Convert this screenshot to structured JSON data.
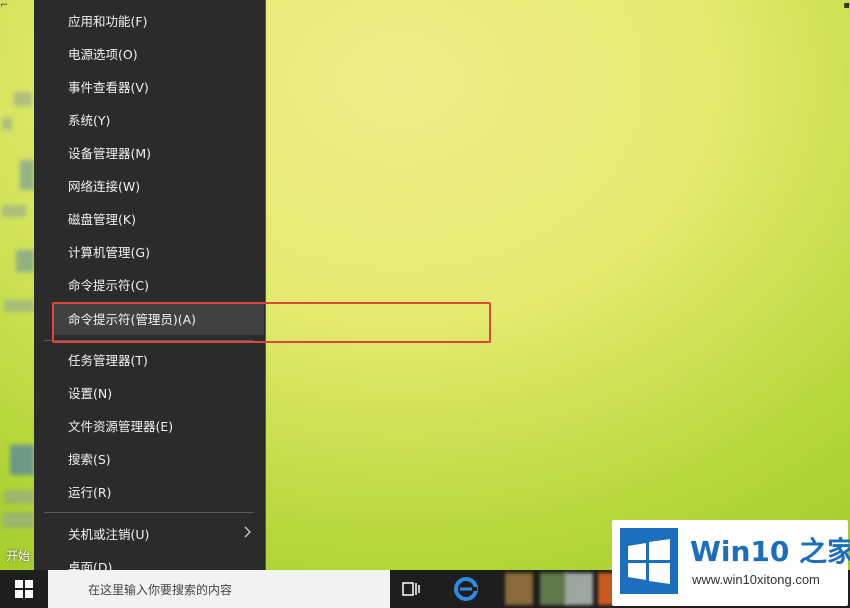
{
  "menu": {
    "items": [
      {
        "label": "应用和功能(F)"
      },
      {
        "label": "电源选项(O)"
      },
      {
        "label": "事件查看器(V)"
      },
      {
        "label": "系统(Y)"
      },
      {
        "label": "设备管理器(M)"
      },
      {
        "label": "网络连接(W)"
      },
      {
        "label": "磁盘管理(K)"
      },
      {
        "label": "计算机管理(G)"
      },
      {
        "label": "命令提示符(C)"
      },
      {
        "label": "命令提示符(管理员)(A)"
      },
      {
        "label": "任务管理器(T)"
      },
      {
        "label": "设置(N)"
      },
      {
        "label": "文件资源管理器(E)"
      },
      {
        "label": "搜索(S)"
      },
      {
        "label": "运行(R)"
      },
      {
        "label": "关机或注销(U)"
      },
      {
        "label": "桌面(D)"
      }
    ],
    "active_item": "命令提示符(管理员)(A)"
  },
  "desktop": {
    "icon_label": "开始"
  },
  "taskbar": {
    "search_placeholder": "在这里输入你要搜索的内容"
  },
  "watermark": {
    "title": "Win10 之家",
    "url": "www.win10xitong.com"
  },
  "colors": {
    "menu_bg": "#2b2b2b",
    "highlight_border": "#e0453a",
    "watermark_blue": "#1c6fbf"
  }
}
